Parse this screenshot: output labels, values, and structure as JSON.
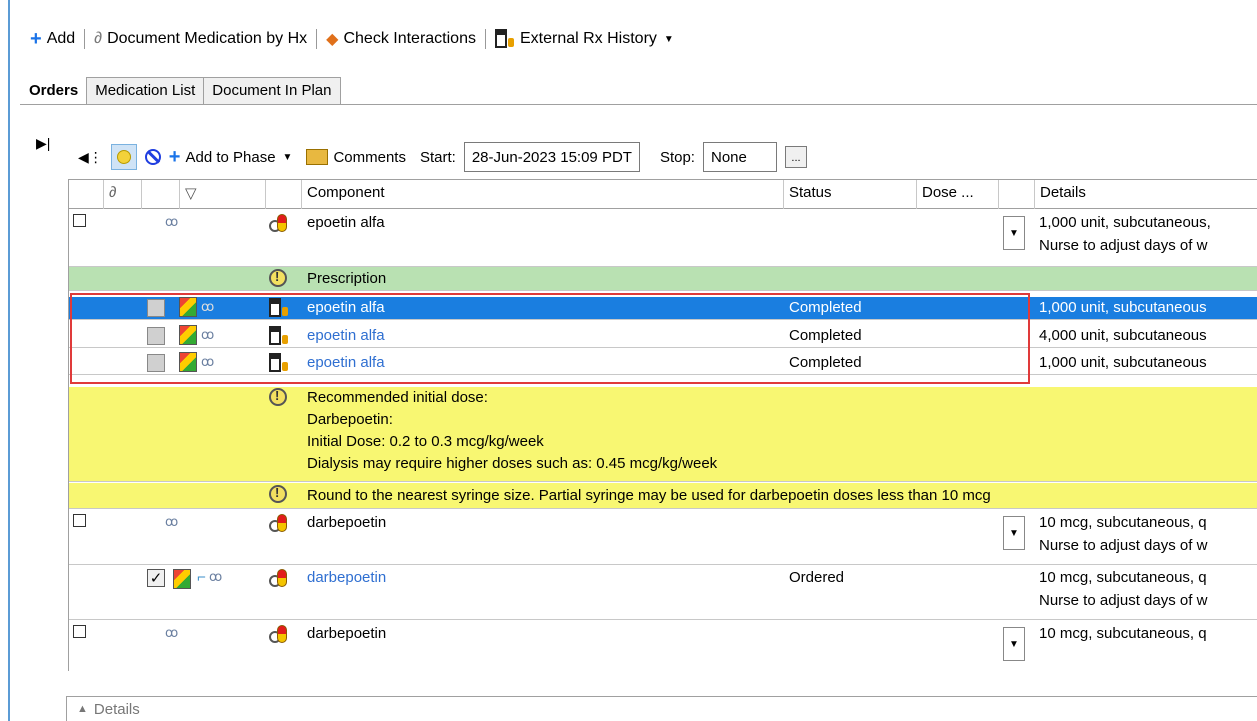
{
  "toolbar": {
    "add": "Add",
    "document_med": "Document Medication by Hx",
    "check_interactions": "Check Interactions",
    "external_rx": "External Rx History"
  },
  "tabs": [
    "Orders",
    "Medication List",
    "Document In Plan"
  ],
  "toolbar2": {
    "add_to_phase": "Add to Phase",
    "comments": "Comments",
    "start_label": "Start:",
    "start_value": "28-Jun-2023 15:09 PDT",
    "stop_label": "Stop:",
    "stop_value": "None",
    "ellipsis": "..."
  },
  "grid": {
    "headers": {
      "component": "Component",
      "status": "Status",
      "dose": "Dose ...",
      "details": "Details"
    },
    "rows": {
      "r1": {
        "component": "epoetin alfa",
        "details1": "1,000 unit, subcutaneous,",
        "details2": "Nurse to adjust days of w"
      },
      "r2": {
        "component": "Prescription"
      },
      "r3": {
        "component": "epoetin alfa",
        "status": "Completed",
        "details": "1,000 unit, subcutaneous"
      },
      "r4": {
        "component": "epoetin alfa",
        "status": "Completed",
        "details": "4,000 unit, subcutaneous"
      },
      "r5": {
        "component": "epoetin alfa",
        "status": "Completed",
        "details": "1,000 unit, subcutaneous"
      },
      "r6": {
        "line1": "Recommended initial dose:",
        "line2": "Darbepoetin:",
        "line3": "Initial Dose: 0.2 to 0.3 mcg/kg/week",
        "line4": "Dialysis may require higher doses such as: 0.45 mcg/kg/week"
      },
      "r7": {
        "text": "Round to the nearest syringe size. Partial syringe may be used for darbepoetin doses less than 10 mcg"
      },
      "r8": {
        "component": "darbepoetin",
        "details1": "10 mcg, subcutaneous, q",
        "details2": "Nurse to adjust days of w"
      },
      "r9": {
        "component": "darbepoetin",
        "status": "Ordered",
        "details1": "10 mcg, subcutaneous, q",
        "details2": "Nurse to adjust days of w"
      },
      "r10": {
        "component": "darbepoetin",
        "details1": "10 mcg, subcutaneous, q"
      }
    }
  },
  "details_bar": "Details",
  "colors": {
    "selection": "#1a7ee0",
    "note_yellow": "#f8f772",
    "section_green": "#b9e1b2",
    "highlight_red": "#e03a3a",
    "link_blue": "#2f6fd1"
  }
}
